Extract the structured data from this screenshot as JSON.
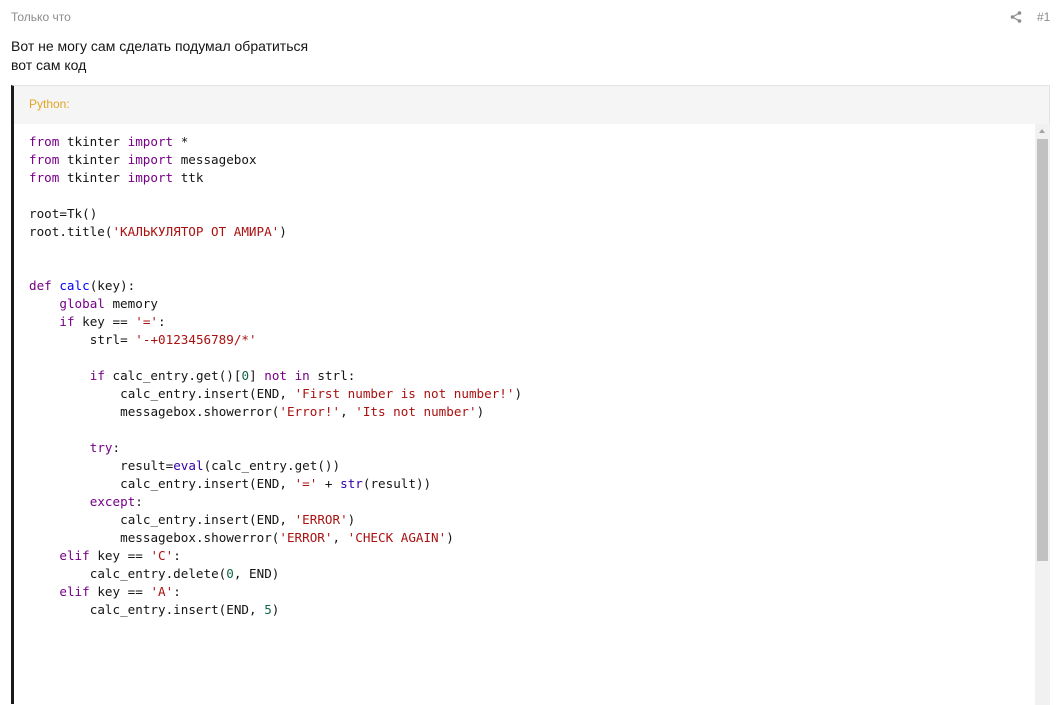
{
  "post": {
    "time": "Только что",
    "number": "#1",
    "share_icon": "share-icon",
    "lines": [
      "Вот не могу сам сделать подумал обратиться",
      "вот сам код"
    ]
  },
  "code_block": {
    "language_label": "Python:",
    "code": "from tkinter import *\nfrom tkinter import messagebox\nfrom tkinter import ttk\n\nroot=Tk()\nroot.title('КАЛЬКУЛЯТОР ОТ АМИРА')\n\n\ndef calc(key):\n    global memory\n    if key == '=':\n        strl= '-+0123456789/*'\n\n        if calc_entry.get()[0] not in strl:\n            calc_entry.insert(END, 'First number is not number!')\n            messagebox.showerror('Error!', 'Its not number')\n\n        try:\n            result=eval(calc_entry.get())\n            calc_entry.insert(END, '=' + str(result))\n        except:\n            calc_entry.insert(END, 'ERROR')\n            messagebox.showerror('ERROR', 'CHECK AGAIN')\n    elif key == 'C':\n        calc_entry.delete(0, END)\n    elif key == 'A':\n        calc_entry.insert(END, 5)"
  },
  "colors": {
    "keyword": "#770088",
    "string": "#aa1111",
    "number": "#116644",
    "builtin": "#3300aa",
    "def_name": "#0000ff",
    "language_label": "#e0a526"
  }
}
